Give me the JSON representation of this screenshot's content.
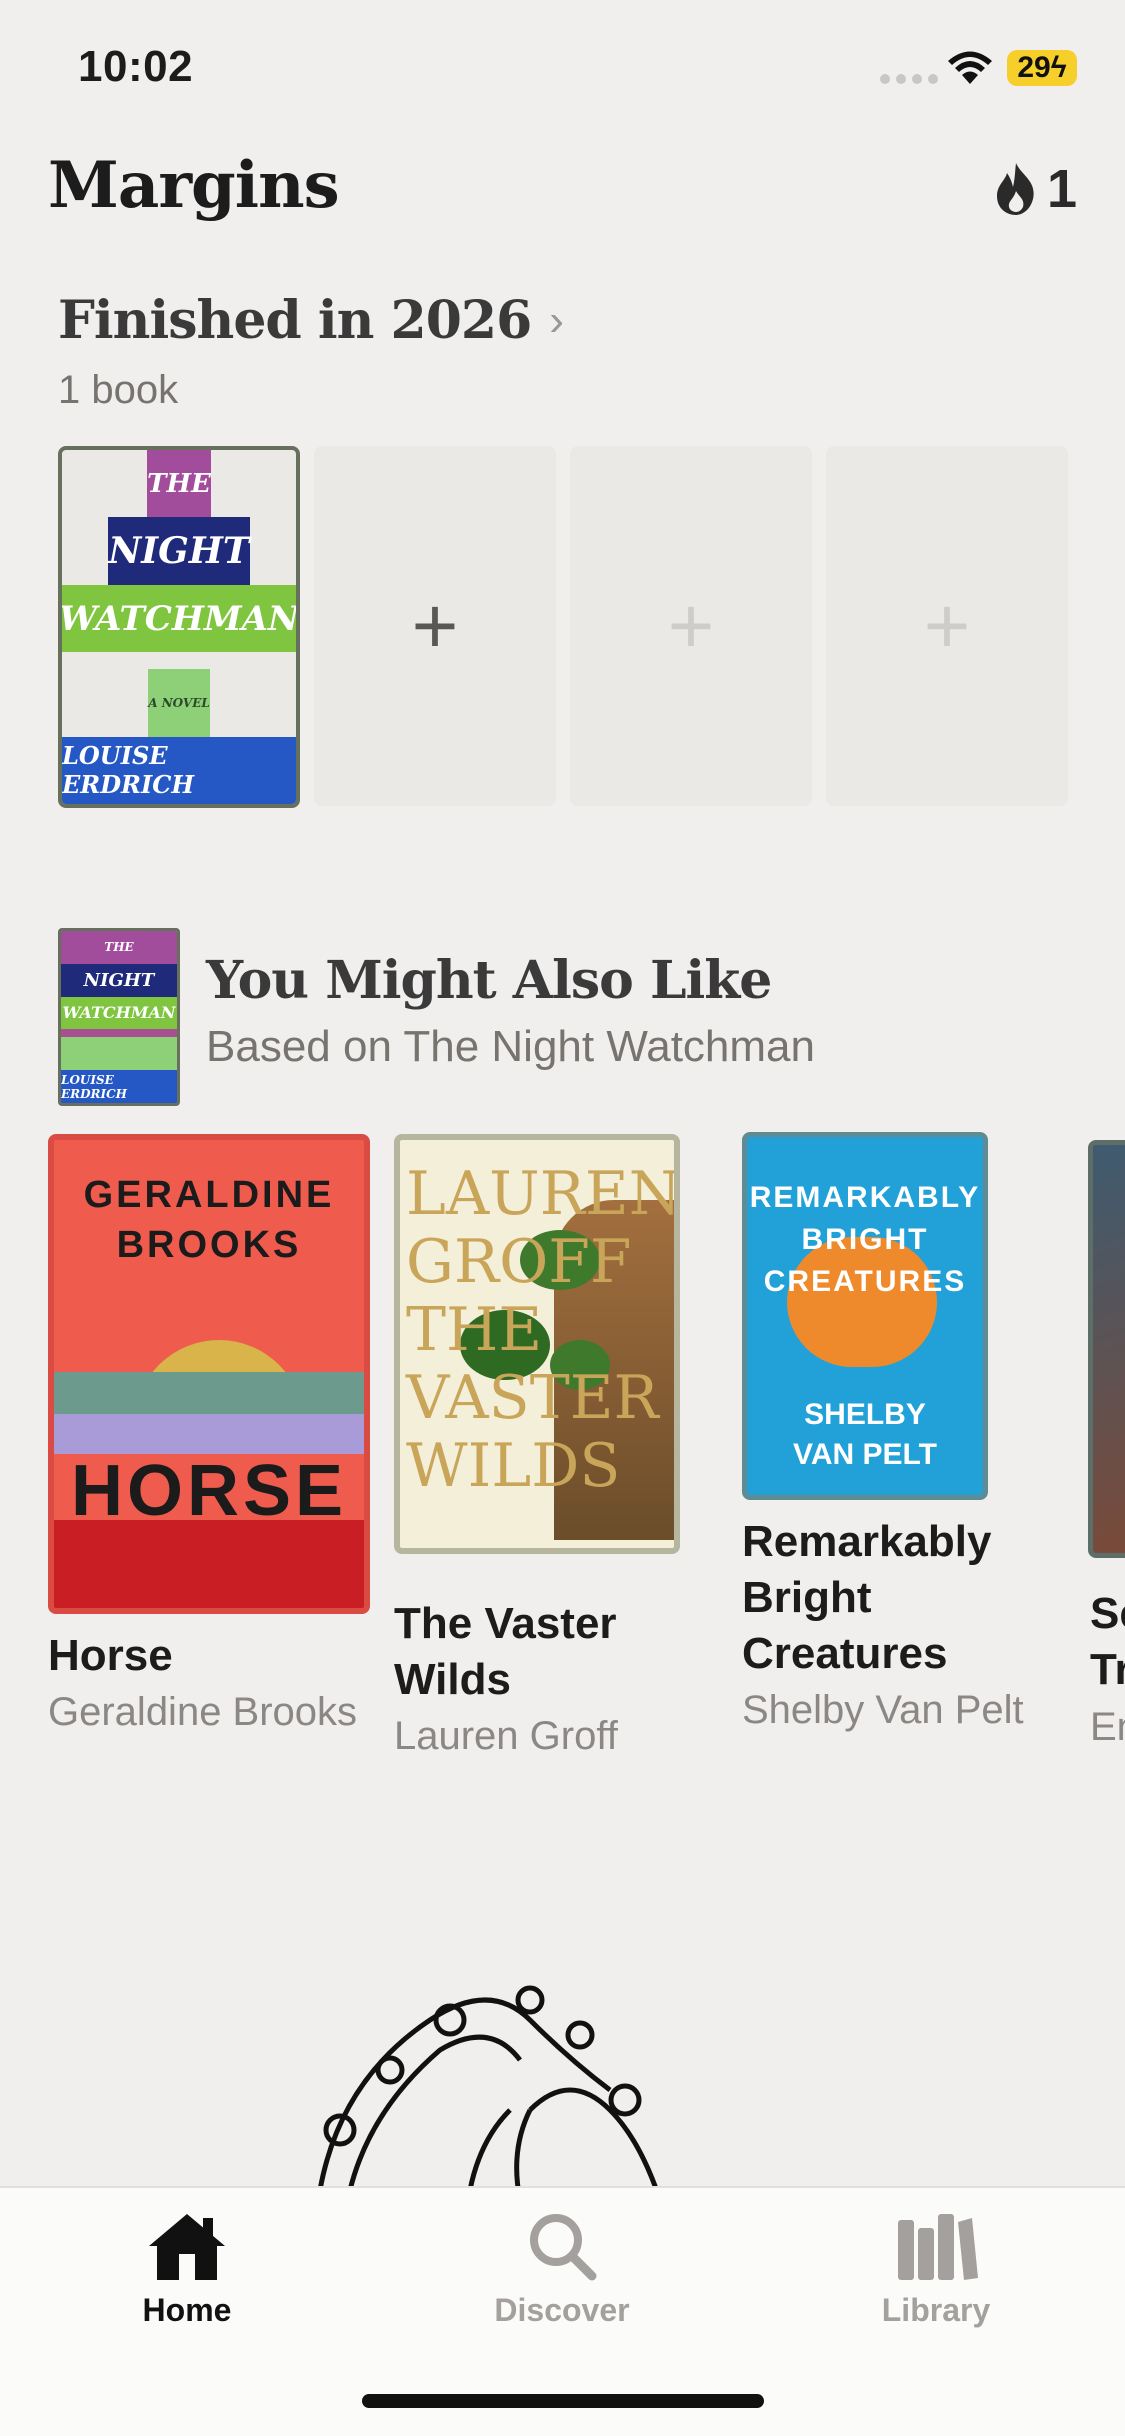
{
  "status_bar": {
    "time": "10:02",
    "battery": "29"
  },
  "header": {
    "app_title": "Margins",
    "streak_count": "1"
  },
  "finished": {
    "title": "Finished in 2026",
    "count": "1 book",
    "cover": {
      "line1": "THE",
      "line2": "NIGHT",
      "line3": "WATCHMAN",
      "line4": "A NOVEL",
      "line5": "LOUISE ERDRICH"
    },
    "empty_slot_symbol": "+"
  },
  "recommendations": {
    "title": "You Might Also Like",
    "subtitle": "Based on The Night Watchman",
    "items": [
      {
        "title": "Horse",
        "author": "Geraldine Brooks",
        "cover_author_line1": "GERALDINE",
        "cover_author_line2": "BROOKS",
        "cover_word": "HORSE"
      },
      {
        "title": "The Vaster Wilds",
        "author": "Lauren Groff",
        "cover_word_1": "LAUREN",
        "cover_word_2": "GROFF",
        "cover_word_3": "THE VASTER",
        "cover_word_4": "WILDS"
      },
      {
        "title": "Remarkably Bright Creatures",
        "author": "Shelby Van Pelt",
        "cover_word_1": "REMARKABLY",
        "cover_word_2": "BRIGHT",
        "cover_word_3": "CREATURES",
        "cover_author_1": "SHELBY",
        "cover_author_2": "VAN PELT"
      },
      {
        "title_partial_1": "Se",
        "title_partial_2": "Tr",
        "author_partial": "En"
      }
    ]
  },
  "tabbar": {
    "tabs": [
      {
        "label": "Home",
        "icon": "home-icon",
        "active": true
      },
      {
        "label": "Discover",
        "icon": "search-icon",
        "active": false
      },
      {
        "label": "Library",
        "icon": "library-icon",
        "active": false
      }
    ]
  }
}
